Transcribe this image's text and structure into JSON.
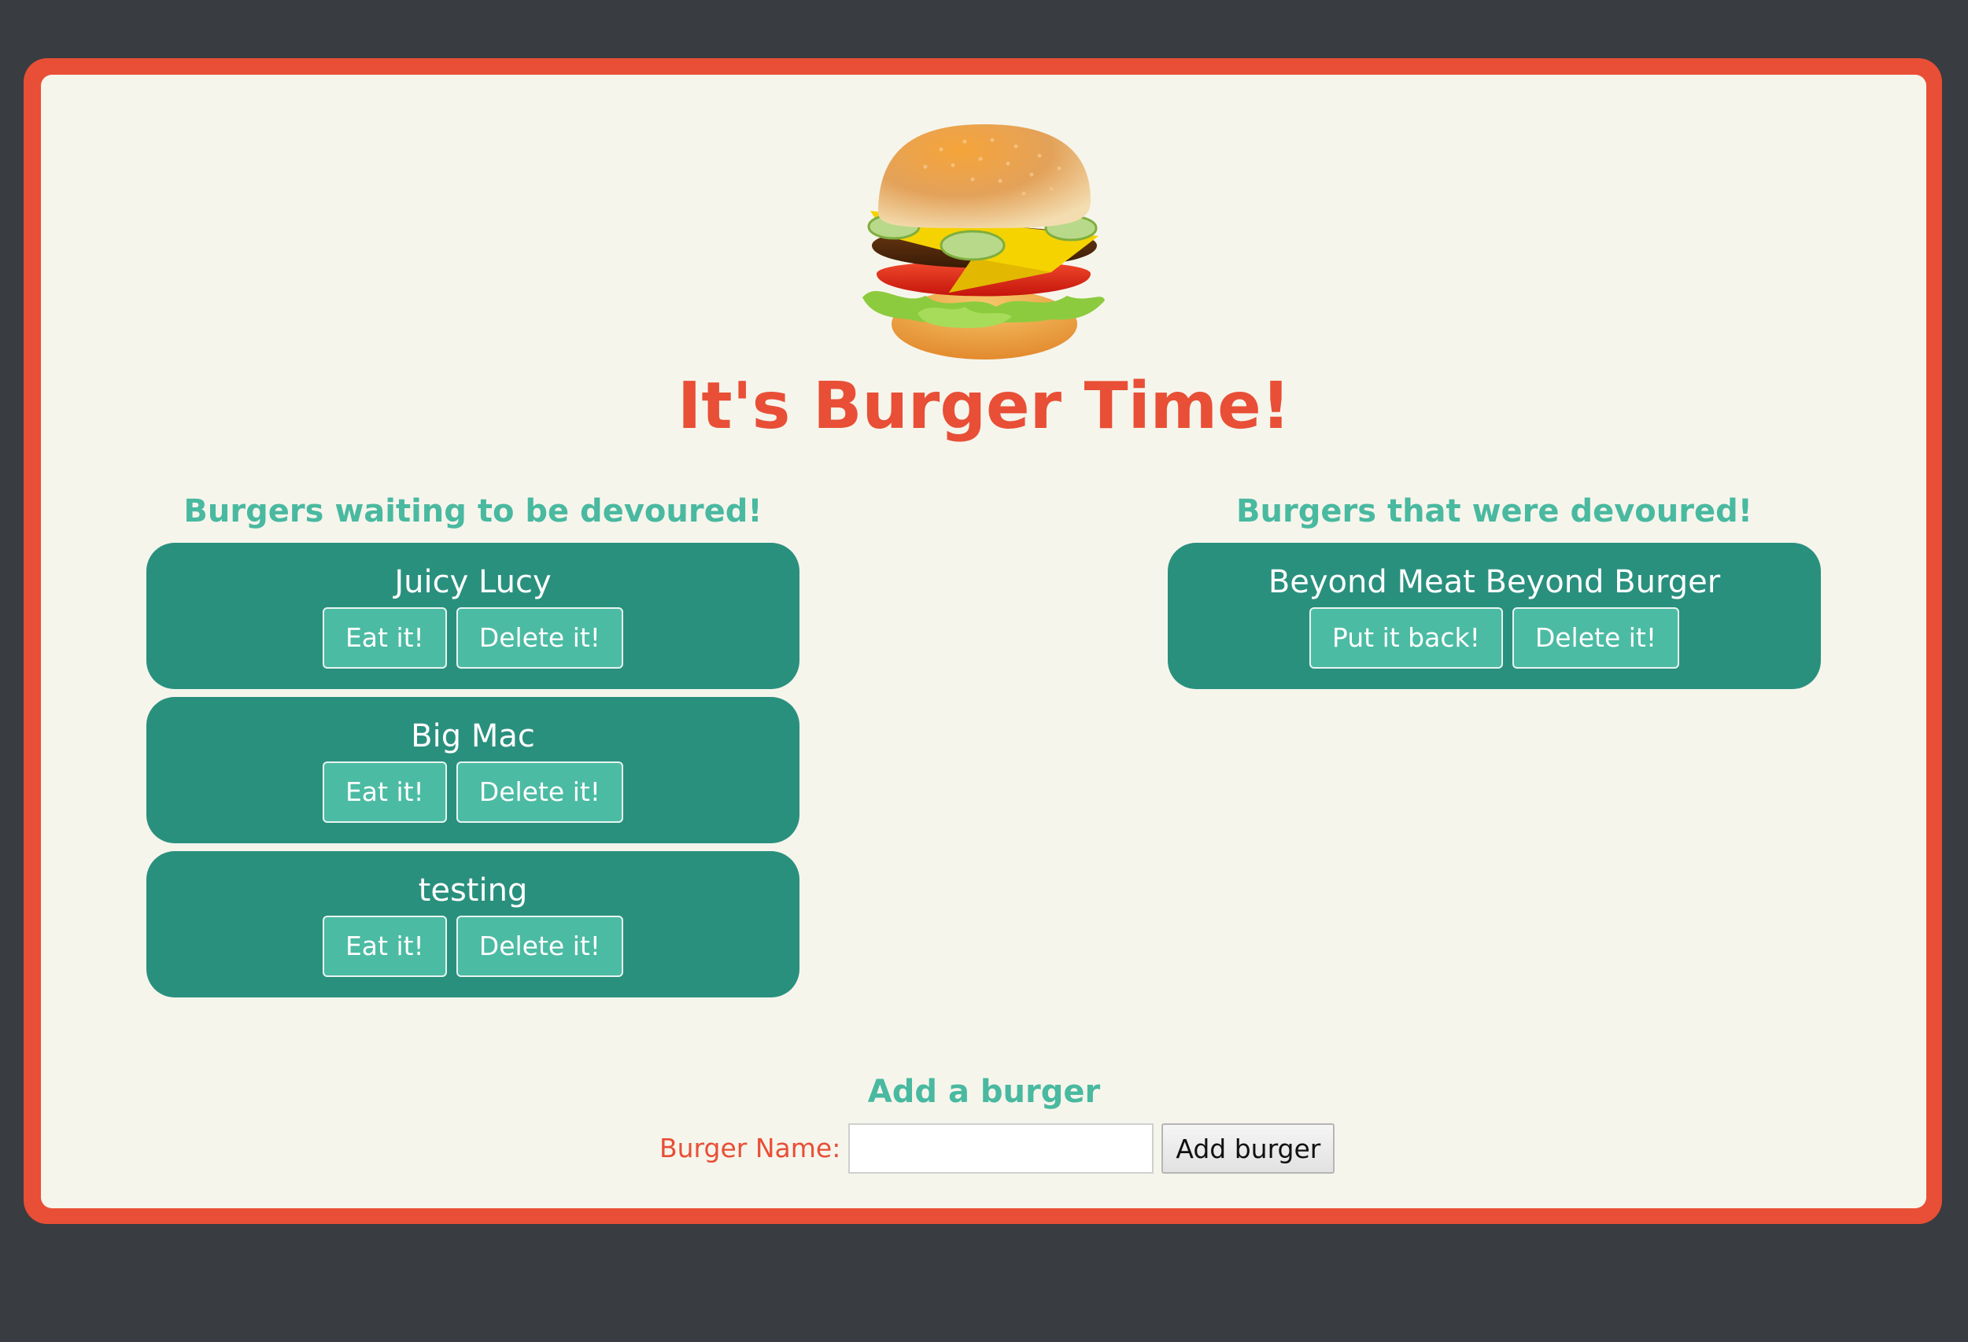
{
  "page": {
    "title": "It's Burger Time!",
    "logo_icon": "burger-icon"
  },
  "waiting": {
    "heading": "Burgers waiting to be devoured!",
    "items": [
      {
        "name": "Juicy Lucy",
        "primary_label": "Eat it!",
        "delete_label": "Delete it!"
      },
      {
        "name": "Big Mac",
        "primary_label": "Eat it!",
        "delete_label": "Delete it!"
      },
      {
        "name": "testing",
        "primary_label": "Eat it!",
        "delete_label": "Delete it!"
      }
    ]
  },
  "devoured": {
    "heading": "Burgers that were devoured!",
    "items": [
      {
        "name": "Beyond Meat Beyond Burger",
        "primary_label": "Put it back!",
        "delete_label": "Delete it!"
      }
    ]
  },
  "add_form": {
    "heading": "Add a burger",
    "label": "Burger Name:",
    "input_value": "",
    "submit_label": "Add burger"
  },
  "colors": {
    "accent_red": "#e84f36",
    "teal": "#2a907e",
    "teal_light": "#49b9a0",
    "background": "#393c41",
    "panel": "#f6f5ec"
  }
}
